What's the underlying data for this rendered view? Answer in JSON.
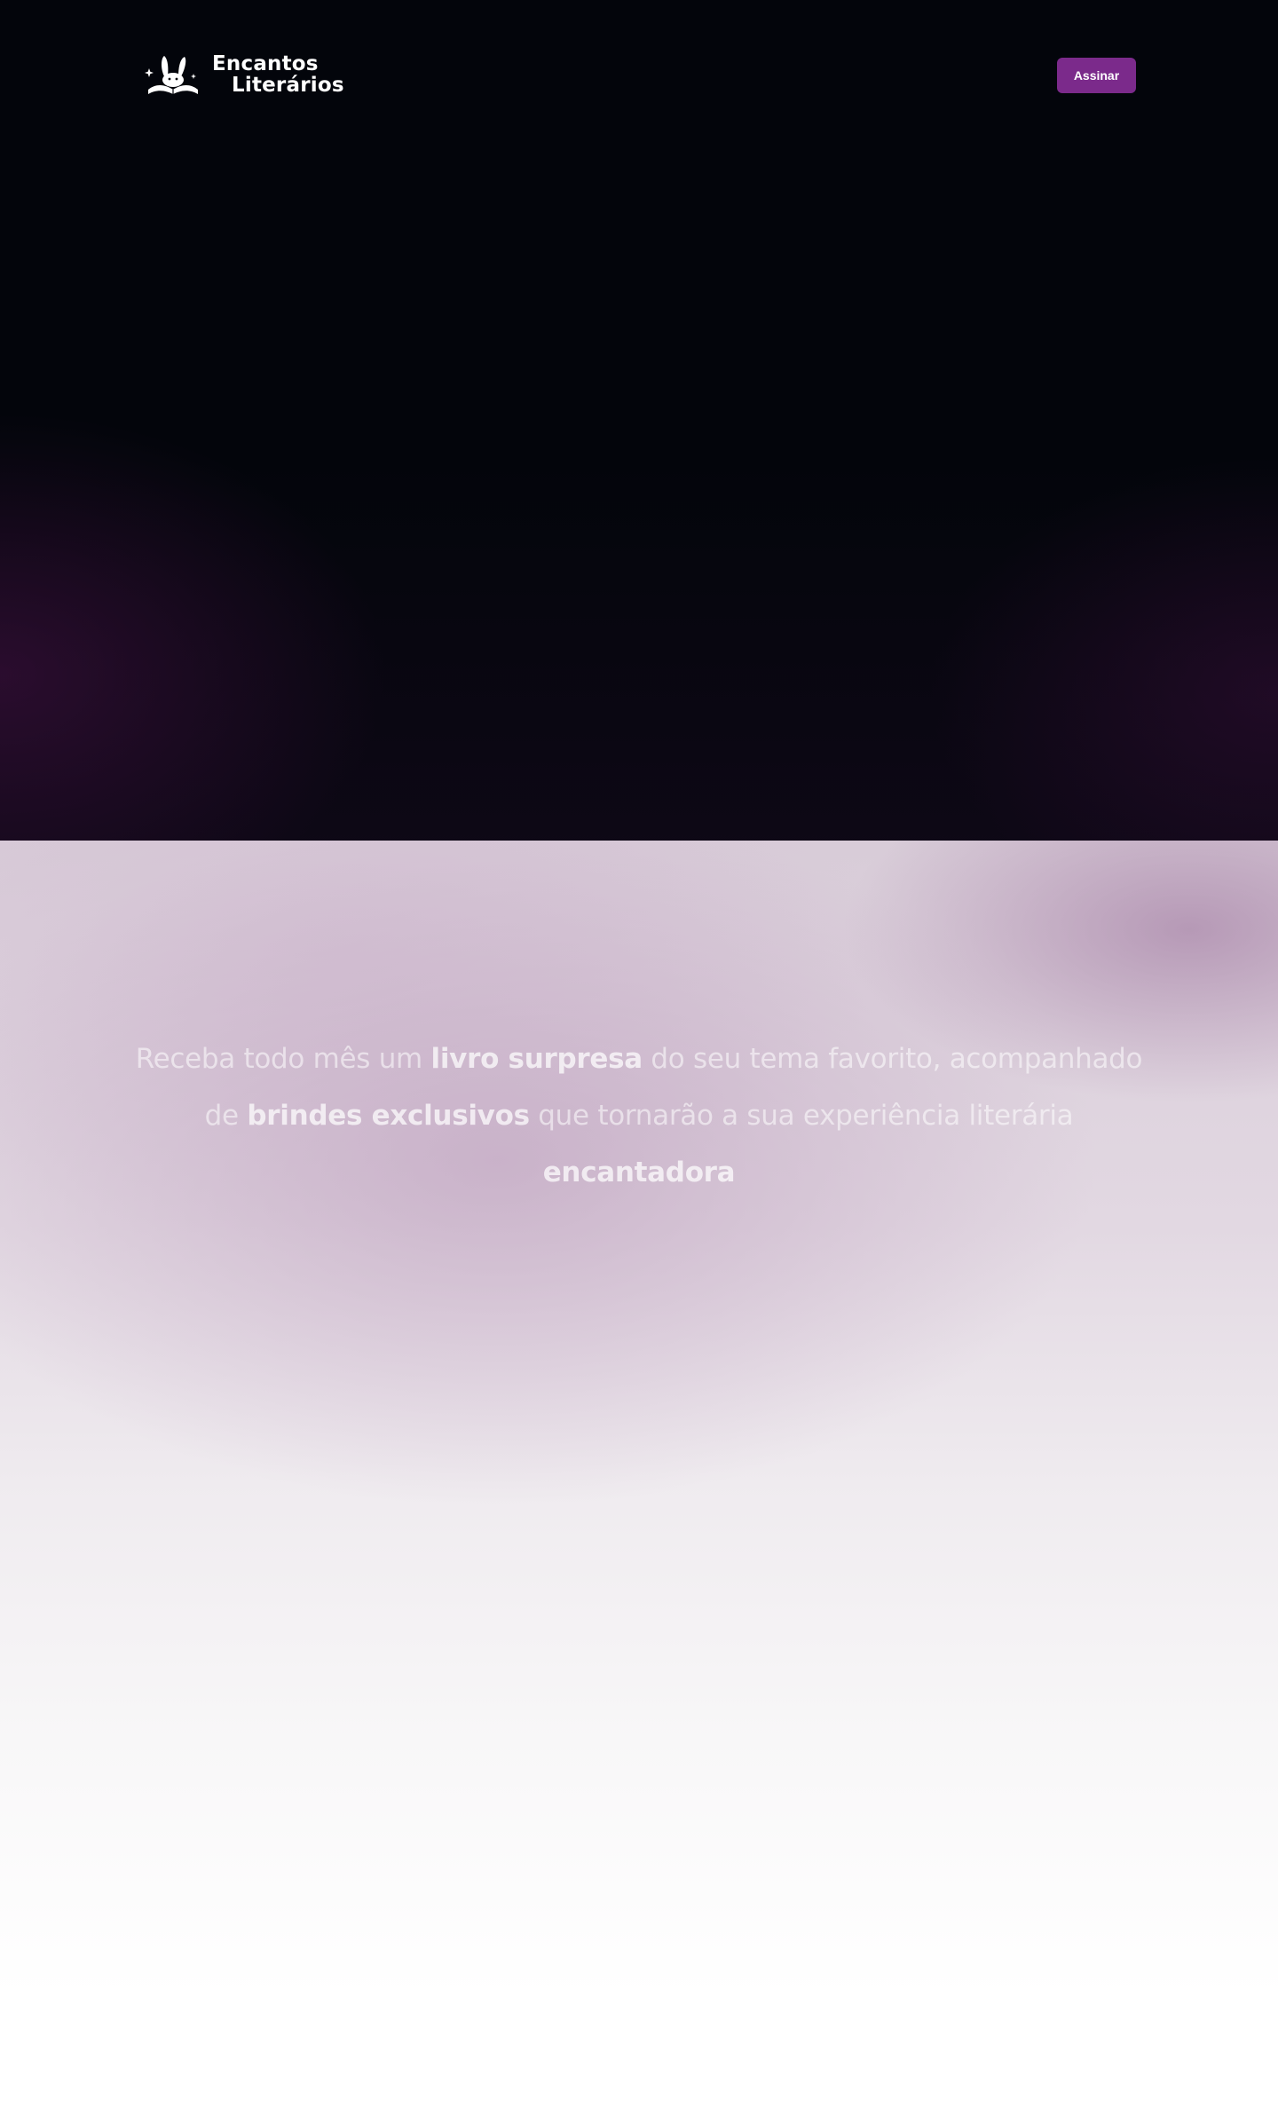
{
  "header": {
    "logo": {
      "line1": "Encantos",
      "line2": "Literários",
      "icon": "bunny-book-logo-icon"
    },
    "subscribe_label": "Assinar"
  },
  "intro": {
    "parts": [
      "Receba todo mês um ",
      "livro surpresa",
      " do seu tema favorito, acompanhado de ",
      "brindes exclusivos",
      " que tornarão a sua experiência literária ",
      "encantadora"
    ]
  },
  "colors": {
    "hero_bg": "#03050b",
    "accent": "#7b2a8b",
    "text_light": "#ffffff"
  }
}
